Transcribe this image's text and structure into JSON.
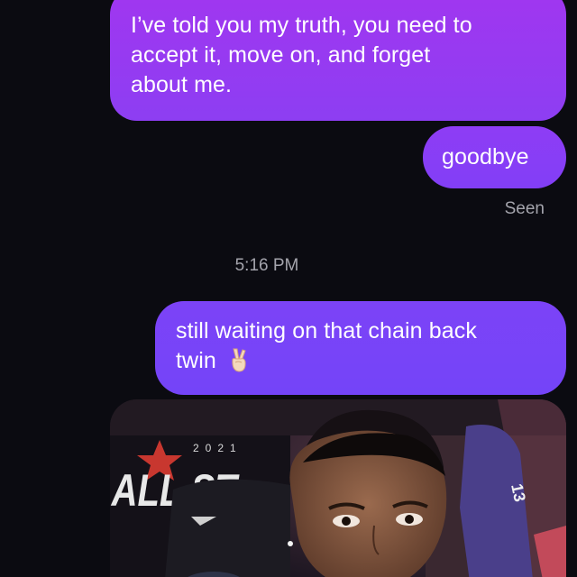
{
  "thread": {
    "messages": [
      {
        "text_line_1": "I’ve told you my truth, you need to",
        "text_line_2": "accept it, move on, and forget",
        "text_line_3": "about me."
      },
      {
        "text": "goodbye"
      }
    ],
    "seen_label": "Seen",
    "timestamp": "5:16 PM",
    "later_message": {
      "text_line_1": "still waiting on that chain back",
      "text_line_2": "twin",
      "emoji": "victory-hand-emoji"
    },
    "attachment": {
      "type": "photo",
      "overlay_year": "2021",
      "overlay_text": "ALL ST",
      "jersey_number": "13"
    }
  },
  "colors": {
    "background": "#0b0b11",
    "bubble_top": "#a136f0",
    "bubble_mid": "#8e3df5",
    "bubble_bottom": "#7444f8",
    "meta_text": "#a4a4ac"
  }
}
